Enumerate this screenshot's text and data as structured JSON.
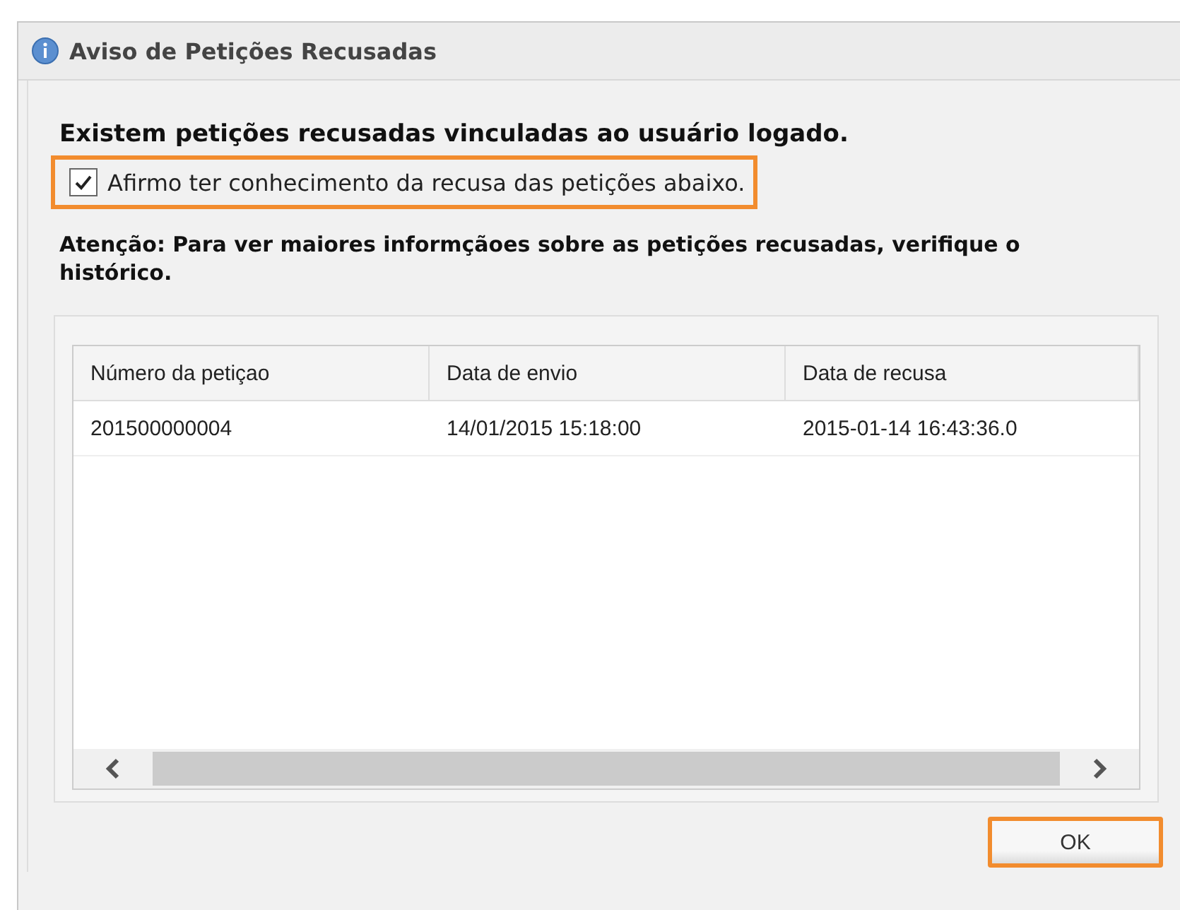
{
  "window": {
    "title": "Aviso de Petições Recusadas"
  },
  "heading": "Existem petições recusadas vinculadas ao usuário logado.",
  "acknowledge": {
    "label": "Afirmo ter conhecimento da recusa das petições abaixo.",
    "checked": true
  },
  "notice": "Atenção: Para ver maiores informçãoes sobre as petições recusadas, verifique o histórico.",
  "table": {
    "columns": [
      "Número da petiçao",
      "Data de envio",
      "Data de recusa"
    ],
    "rows": [
      [
        "201500000004",
        "14/01/2015 15:18:00",
        "2015-01-14 16:43:36.0"
      ]
    ]
  },
  "buttons": [
    "OK"
  ]
}
